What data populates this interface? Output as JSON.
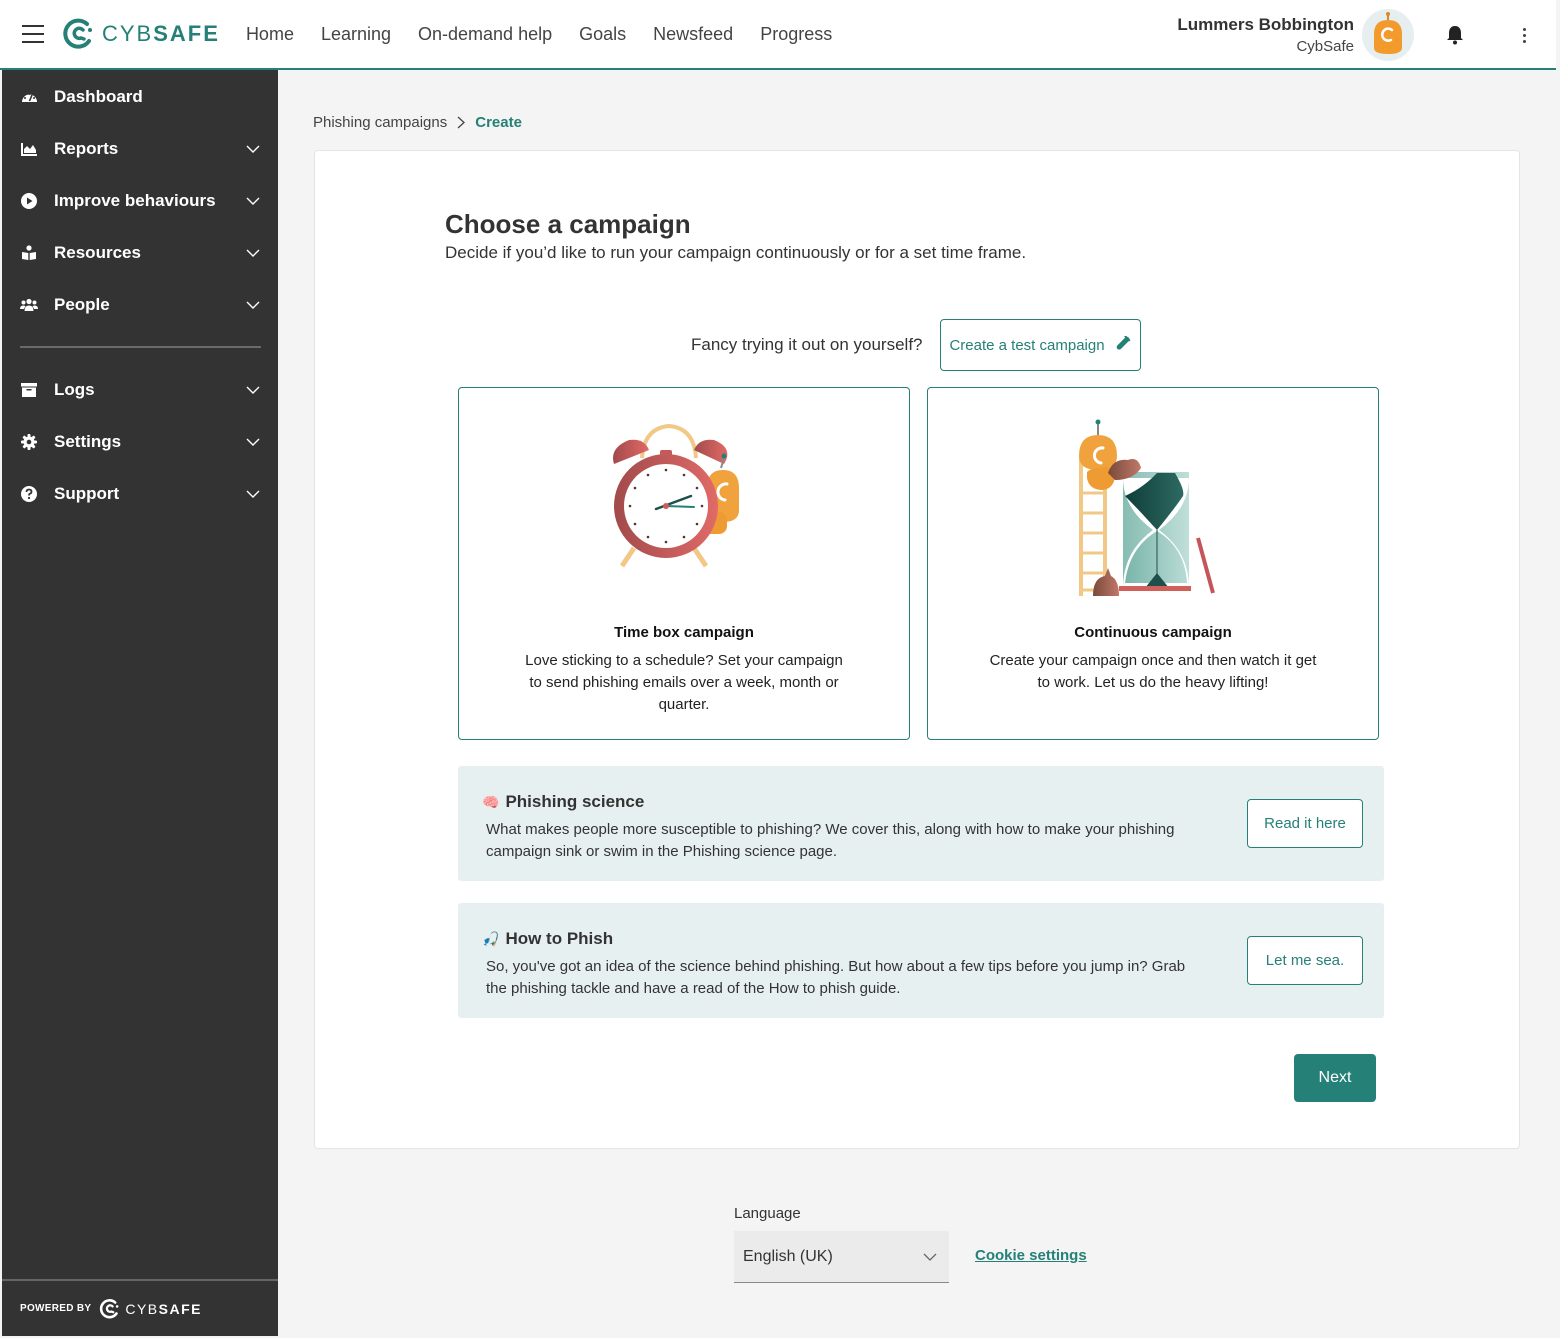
{
  "header": {
    "logo_text_light": "CYB",
    "logo_text_bold": "SAFE",
    "nav": [
      {
        "label": "Home"
      },
      {
        "label": "Learning"
      },
      {
        "label": "On-demand help"
      },
      {
        "label": "Goals"
      },
      {
        "label": "Newsfeed"
      },
      {
        "label": "Progress"
      }
    ],
    "user": {
      "name": "Lummers Bobbington",
      "org": "CybSafe"
    },
    "icons": {
      "menu": "hamburger-icon",
      "notifications": "bell-icon",
      "more": "kebab-icon"
    }
  },
  "sidebar": {
    "items": [
      {
        "label": "Dashboard",
        "icon": "dashboard-gauge-icon",
        "expandable": false
      },
      {
        "label": "Reports",
        "icon": "area-chart-icon",
        "expandable": true
      },
      {
        "label": "Improve behaviours",
        "icon": "play-circle-icon",
        "expandable": true
      },
      {
        "label": "Resources",
        "icon": "reader-book-icon",
        "expandable": true
      },
      {
        "label": "People",
        "icon": "users-icon",
        "expandable": true
      },
      {
        "label": "Logs",
        "icon": "archive-box-icon",
        "expandable": true
      },
      {
        "label": "Settings",
        "icon": "gear-icon",
        "expandable": true
      },
      {
        "label": "Support",
        "icon": "question-circle-icon",
        "expandable": true
      }
    ],
    "footer": {
      "powered_by": "POWERED BY",
      "logo_light": "CYB",
      "logo_bold": "SAFE"
    }
  },
  "breadcrumb": {
    "parent": "Phishing campaigns",
    "current": "Create"
  },
  "main": {
    "title": "Choose a campaign",
    "subtitle": "Decide if you’d like to run your campaign continuously or for a set time frame.",
    "try_text": "Fancy trying it out on yourself?",
    "test_button": "Create a test campaign",
    "cards": [
      {
        "title": "Time box campaign",
        "description": "Love sticking to a schedule? Set your campaign to send phishing emails over a week, month or quarter.",
        "illustration": "alarm-clock-robot-illustration"
      },
      {
        "title": "Continuous campaign",
        "description": "Create your campaign once and then watch it get to work. Let us do the heavy lifting!",
        "illustration": "hourglass-ladder-robot-illustration"
      }
    ],
    "info_boxes": [
      {
        "emoji": "🧠",
        "title": "Phishing science",
        "text": "What makes people more susceptible to phishing? We cover this, along with how to make your phishing campaign sink or swim in the Phishing science page.",
        "button": "Read it here"
      },
      {
        "emoji": "🎣",
        "title": "How to Phish",
        "text": "So, you've got an idea of the science behind phishing. But how about a few tips before you jump in? Grab the phishing tackle and have a read of the How to phish guide.",
        "button": "Let me sea."
      }
    ],
    "next_button": "Next"
  },
  "footer": {
    "language_label": "Language",
    "language_value": "English (UK)",
    "cookie_link": "Cookie settings"
  },
  "colors": {
    "brand": "#258078",
    "sidebar_bg": "#333333",
    "info_bg": "#e7f0f1",
    "robot_orange": "#f0a23c",
    "clock_red": "#c4555a"
  }
}
